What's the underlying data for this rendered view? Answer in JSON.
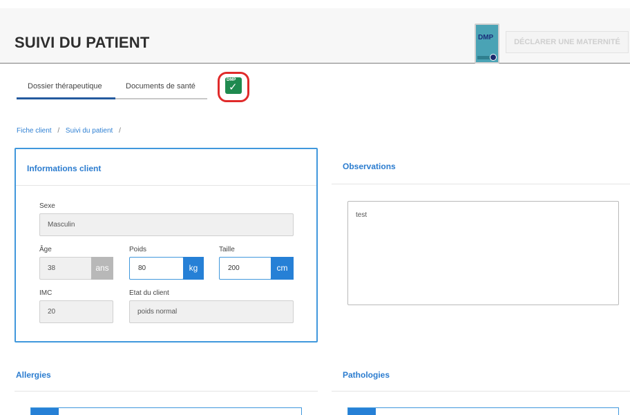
{
  "header": {
    "title": "SUIVI DU PATIENT",
    "dmp_logo_text": "DMP",
    "declare_button": "DÉCLARER UNE MATERNITÉ"
  },
  "tabs": [
    {
      "label": "Dossier thérapeutique",
      "active": true
    },
    {
      "label": "Documents de santé",
      "active": false
    }
  ],
  "dmp_status": {
    "text": "DMP",
    "icon": "check-icon",
    "highlight_color": "#e02a2a"
  },
  "breadcrumb": {
    "items": [
      "Fiche client",
      "Suivi du patient"
    ],
    "separator": "/"
  },
  "client_info": {
    "title": "Informations client",
    "sexe": {
      "label": "Sexe",
      "value": "Masculin"
    },
    "age": {
      "label": "Âge",
      "value": "38",
      "unit": "ans"
    },
    "poids": {
      "label": "Poids",
      "value": "80",
      "unit": "kg"
    },
    "taille": {
      "label": "Taille",
      "value": "200",
      "unit": "cm"
    },
    "imc": {
      "label": "IMC",
      "value": "20"
    },
    "etat": {
      "label": "Etat du client",
      "value": "poids normal"
    }
  },
  "observations": {
    "title": "Observations",
    "value": "test"
  },
  "allergies": {
    "title": "Allergies"
  },
  "pathologies": {
    "title": "Pathologies"
  },
  "colors": {
    "accent": "#2b7ccf",
    "input_border": "#3f97dc",
    "unit_blue": "#2680d6",
    "dmp_green": "#1f8a4f"
  }
}
